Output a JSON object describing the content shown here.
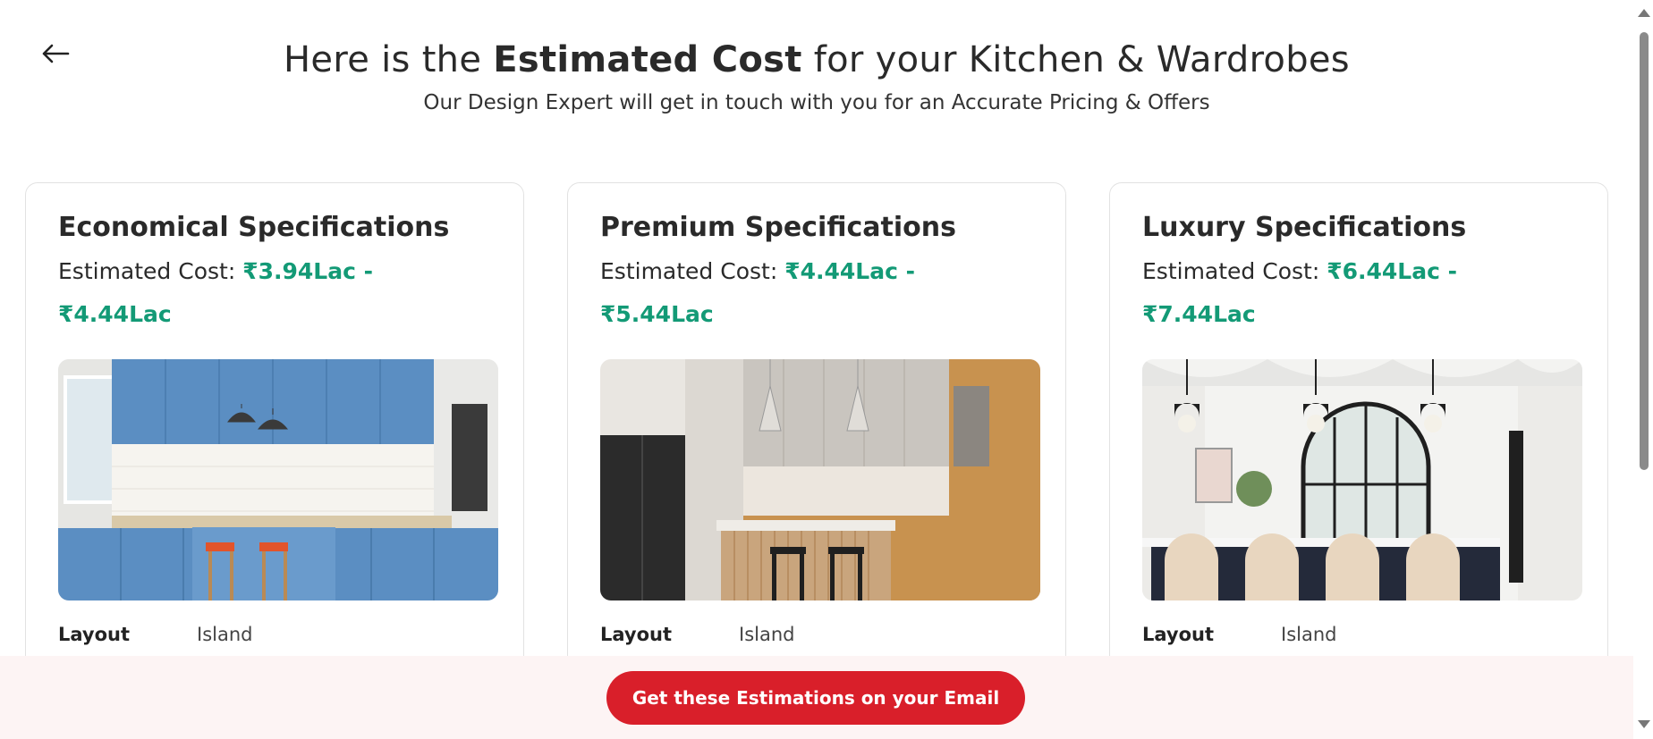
{
  "header": {
    "title_prefix": "Here is the",
    "title_bold": "Estimated Cost",
    "title_suffix": "for your Kitchen & Wardrobes",
    "subtitle": "Our Design Expert will get in touch with you for an Accurate Pricing & Offers"
  },
  "cards": [
    {
      "title": "Economical Specifications",
      "cost_label": "Estimated Cost:",
      "price_from": "₹3.94Lac -",
      "price_to": "₹4.44Lac",
      "layout_label": "Layout",
      "layout_value": "Island",
      "image": "blue-modular-kitchen-image"
    },
    {
      "title": "Premium Specifications",
      "cost_label": "Estimated Cost:",
      "price_from": "₹4.44Lac -",
      "price_to": "₹5.44Lac",
      "layout_label": "Layout",
      "layout_value": "Island",
      "image": "wood-grey-kitchen-image"
    },
    {
      "title": "Luxury Specifications",
      "cost_label": "Estimated Cost:",
      "price_from": "₹6.44Lac -",
      "price_to": "₹7.44Lac",
      "layout_label": "Layout",
      "layout_value": "Island",
      "image": "white-luxury-kitchen-image"
    }
  ],
  "footer": {
    "email_button": "Get these Estimations on your Email"
  },
  "colors": {
    "price_green": "#139a76",
    "cta_red": "#d91f2a",
    "footer_bg": "#fdf4f4"
  }
}
